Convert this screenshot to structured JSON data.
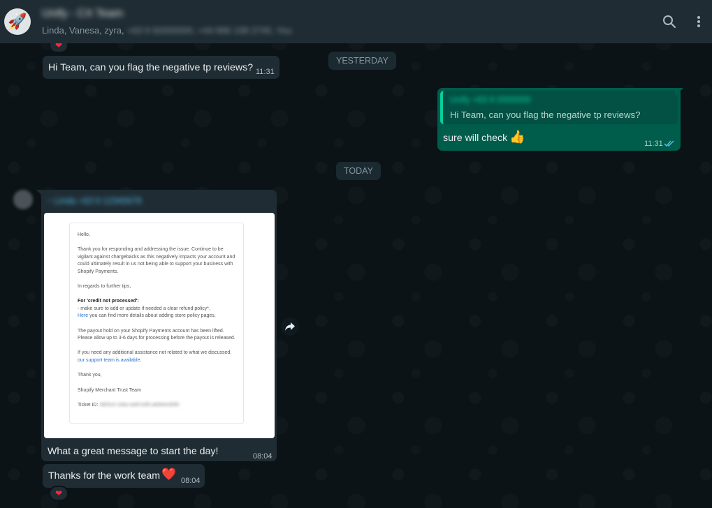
{
  "header": {
    "avatar_emoji": "🚀",
    "group_name": "Unify - CX Team",
    "members_visible": "Linda, Vanesa, zyra,",
    "members_hidden": "+63 9 92000000, +44 896 108 2745, You"
  },
  "dates": {
    "yesterday": "YESTERDAY",
    "today": "TODAY"
  },
  "messages": {
    "m1": {
      "text": "Hi Team, can you flag the negative tp reviews?",
      "time": "11:31"
    },
    "m2": {
      "quote_author": "Unify +63 9 0000000",
      "quote_text": "Hi Team, can you flag the negative tp reviews?",
      "text": "sure will check",
      "emoji": "👍",
      "time": "11:31"
    },
    "m3": {
      "sender": "~ Linda   +63 9 12345678",
      "caption": "What a great message to start the day!",
      "time": "08:04"
    },
    "m4": {
      "text": "Thanks for the work team",
      "emoji": "❤️",
      "time": "08:04"
    }
  },
  "email": {
    "greeting": "Hello,",
    "p1": "Thank you for responding and addressing the issue. Continue to be vigilant against chargebacks as this negatively impacts your account and could ultimately result in us not being able to support your business with Shopify Payments.",
    "p2": "In regards to further tips,",
    "p3_bold": "For 'credit not processed':",
    "p3_line": "- make sure to add or update if needed a clear refund policy*.",
    "p3_link": "Here",
    "p3_rest": " you can find more details about adding store policy pages.",
    "p4": "The payout hold on your Shopify Payments account has been lifted. Please allow up to 3-6 days for processing before the payout is released.",
    "p5": "If you need any additional assistance not related to what we discussed, ",
    "p5_link": "our support team is available",
    "p5_end": ".",
    "thanks": "Thank you,",
    "team": "Shopify Merchant Trust Team",
    "ticket_label": "Ticket ID:",
    "ticket_id": "4805c0-1b6a-4a5f-b3f5-ab0b0e3f0f0"
  },
  "icons": {
    "search": "search-icon",
    "menu": "kebab-menu-icon",
    "forward": "forward-icon",
    "read": "double-check-icon",
    "reaction": "heart-icon"
  },
  "colors": {
    "header_bg": "#1f2c33",
    "incoming_bubble": "#1f2c33",
    "outgoing_bubble": "#005c4b",
    "accent": "#06cf9c",
    "read_receipt": "#53bdeb"
  }
}
